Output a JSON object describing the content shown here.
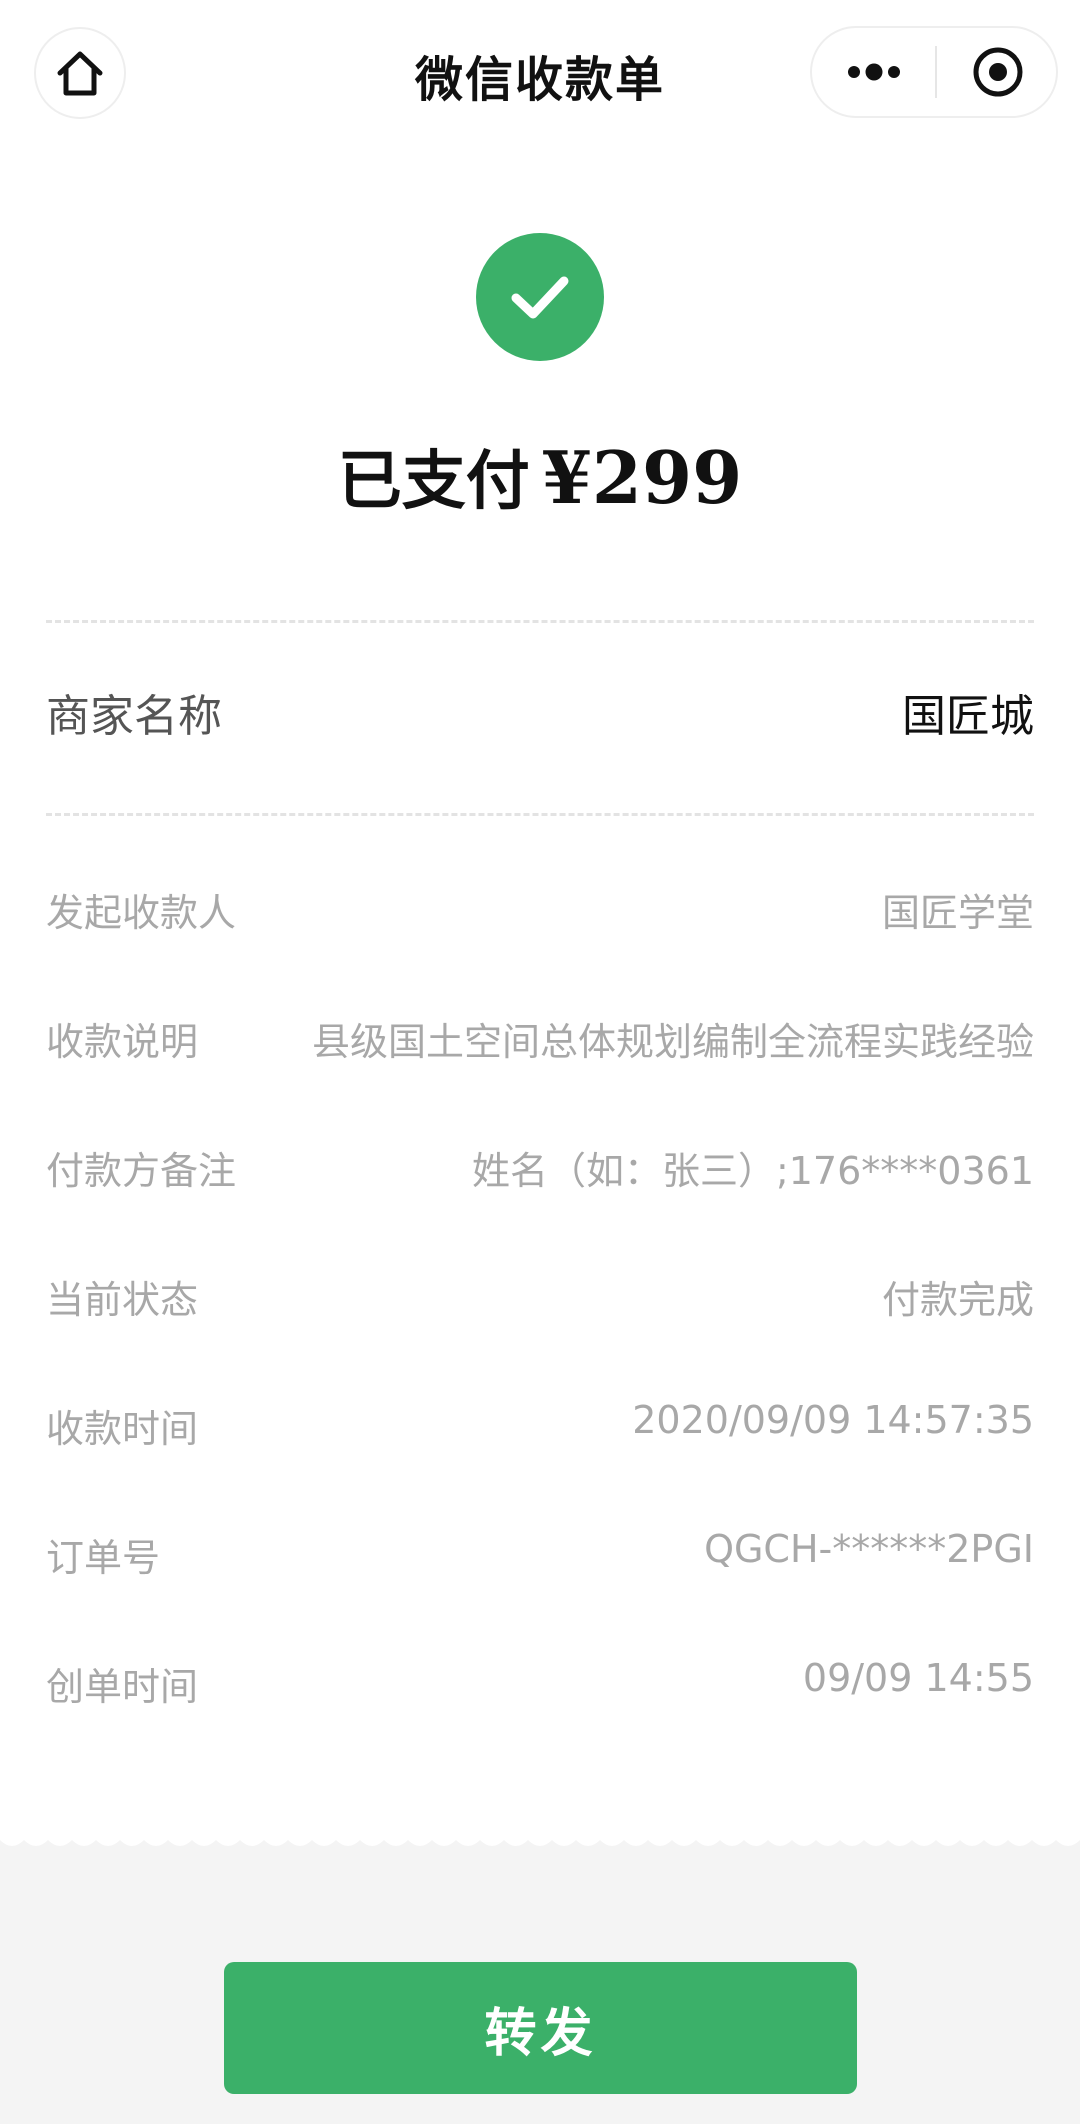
{
  "nav": {
    "title": "微信收款单",
    "home_icon": "home-icon",
    "more_icon": "more-dots-icon",
    "close_icon": "target-close-icon"
  },
  "payment": {
    "status": "已支付",
    "amount": "¥299",
    "status_icon": "check-circle-icon",
    "accent_color": "#3bb069"
  },
  "merchant": {
    "label": "商家名称",
    "value": "国匠城"
  },
  "details": [
    {
      "label": "发起收款人",
      "value": "国匠学堂"
    },
    {
      "label": "收款说明",
      "value": "县级国土空间总体规划编制全流程实践经验"
    },
    {
      "label": "付款方备注",
      "value": "姓名（如：张三）;176****0361"
    },
    {
      "label": "当前状态",
      "value": "付款完成"
    },
    {
      "label": "收款时间",
      "value": "2020/09/09 14:57:35"
    },
    {
      "label": "订单号",
      "value": "QGCH-******2PGI"
    },
    {
      "label": "创单时间",
      "value": "09/09 14:55"
    }
  ],
  "actions": {
    "forward_label": "转发"
  }
}
